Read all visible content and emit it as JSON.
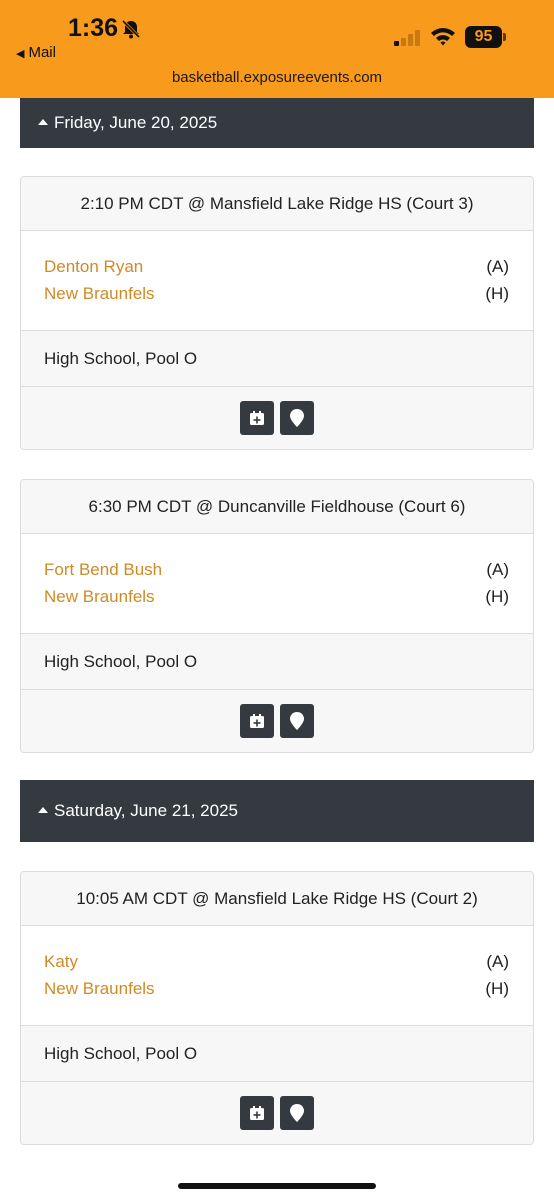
{
  "status_bar": {
    "time": "1:36",
    "back_label": "Mail",
    "battery": "95",
    "url": "basketball.exposureevents.com"
  },
  "colors": {
    "accent": "#f89a1c",
    "header_dark": "#343a40",
    "team_link": "#d08a24"
  },
  "days": [
    {
      "label": "Friday, June 20, 2025",
      "games": [
        {
          "time_location": "2:10 PM CDT @ Mansfield Lake Ridge HS (Court 3)",
          "teams": [
            {
              "name": "Denton Ryan",
              "side": "(A)"
            },
            {
              "name": "New Braunfels",
              "side": "(H)"
            }
          ],
          "division": "High School, Pool O",
          "icons": [
            "calendar-add-icon",
            "map-marker-icon"
          ]
        },
        {
          "time_location": "6:30 PM CDT @ Duncanville Fieldhouse (Court 6)",
          "teams": [
            {
              "name": "Fort Bend Bush",
              "side": "(A)"
            },
            {
              "name": "New Braunfels",
              "side": "(H)"
            }
          ],
          "division": "High School, Pool O",
          "icons": [
            "calendar-add-icon",
            "map-marker-icon"
          ]
        }
      ]
    },
    {
      "label": "Saturday, June 21, 2025",
      "games": [
        {
          "time_location": "10:05 AM CDT @ Mansfield Lake Ridge HS (Court 2)",
          "teams": [
            {
              "name": "Katy",
              "side": "(A)"
            },
            {
              "name": "New Braunfels",
              "side": "(H)"
            }
          ],
          "division": "High School, Pool O",
          "icons": [
            "calendar-add-icon",
            "map-marker-icon"
          ]
        }
      ]
    }
  ]
}
